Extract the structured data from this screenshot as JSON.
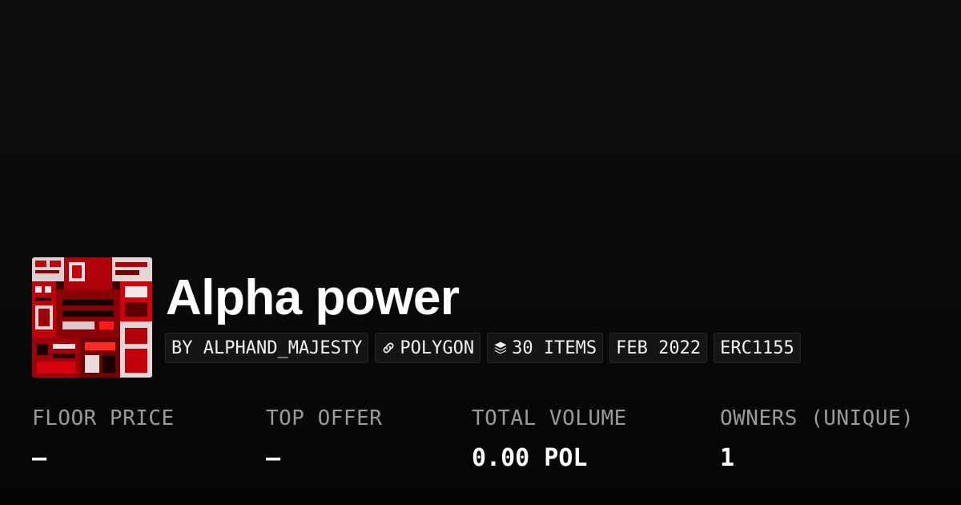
{
  "collection": {
    "title": "Alpha power",
    "tags": [
      {
        "icon": "",
        "text": "BY ALPHAND_MAJESTY"
      },
      {
        "icon": "chain-link-icon",
        "text": "POLYGON"
      },
      {
        "icon": "layers-icon",
        "text": "30 ITEMS"
      },
      {
        "icon": "",
        "text": "FEB 2022"
      },
      {
        "icon": "",
        "text": "ERC1155"
      }
    ]
  },
  "stats": [
    {
      "label": "FLOOR PRICE",
      "value": "—"
    },
    {
      "label": "TOP OFFER",
      "value": "—"
    },
    {
      "label": "TOTAL VOLUME",
      "value": "0.00 POL"
    },
    {
      "label": "OWNERS (UNIQUE)",
      "value": "1"
    }
  ],
  "colors": {
    "background": "#0a0a0a",
    "tag_background": "#151515",
    "label_gray": "#9a9a9a",
    "thumbnail_red": "#c8000a"
  }
}
